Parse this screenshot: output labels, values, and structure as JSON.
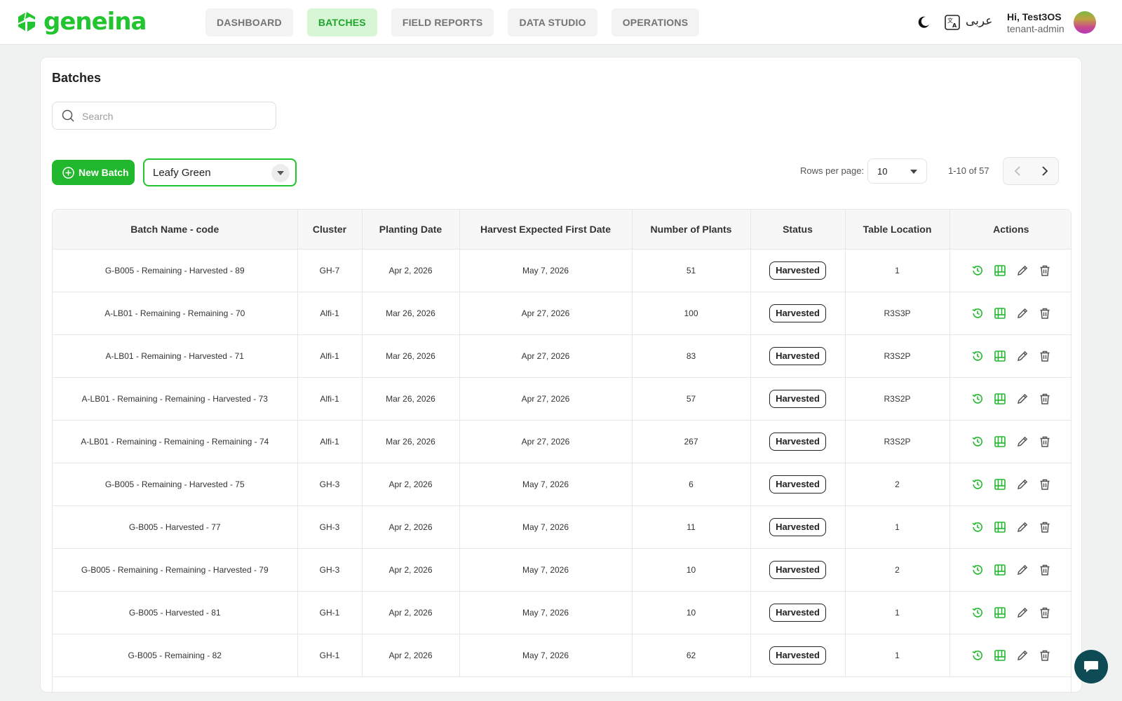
{
  "app": {
    "logo_text": "geneina"
  },
  "nav": {
    "tabs": [
      {
        "label": "DASHBOARD",
        "active": false
      },
      {
        "label": "BATCHES",
        "active": true
      },
      {
        "label": "FIELD REPORTS",
        "active": false
      },
      {
        "label": "DATA STUDIO",
        "active": false
      },
      {
        "label": "OPERATIONS",
        "active": false
      }
    ]
  },
  "header": {
    "theme_icon": "moon-icon",
    "translate_icon": "translate-icon",
    "language_label": "عربى",
    "greeting": "Hi, Test3OS",
    "role": "tenant-admin"
  },
  "page": {
    "title": "Batches",
    "search_placeholder": "Search",
    "new_batch_label": "New Batch",
    "crop_filter": "Leafy Green",
    "rows_per_page_label": "Rows per page:",
    "rows_per_page_value": "10",
    "range_text": "1-10 of 57"
  },
  "colors": {
    "brand": "#22c52f",
    "active_tab_bg": "#d7f6d6",
    "chat": "#0e4b55"
  },
  "table": {
    "columns": [
      "Batch Name - code",
      "Cluster",
      "Planting Date",
      "Harvest Expected First Date",
      "Number of Plants",
      "Status",
      "Table Location",
      "Actions"
    ],
    "rows": [
      {
        "name": "G-B005 - Remaining - Harvested - 89",
        "cluster": "GH-7",
        "planting": "Apr 2, 2026",
        "harvest": "May 7, 2026",
        "plants": "51",
        "status": "Harvested",
        "location": "1"
      },
      {
        "name": "A-LB01 - Remaining - Remaining - 70",
        "cluster": "Alfi-1",
        "planting": "Mar 26, 2026",
        "harvest": "Apr 27, 2026",
        "plants": "100",
        "status": "Harvested",
        "location": "R3S3P"
      },
      {
        "name": "A-LB01 - Remaining - Harvested - 71",
        "cluster": "Alfi-1",
        "planting": "Mar 26, 2026",
        "harvest": "Apr 27, 2026",
        "plants": "83",
        "status": "Harvested",
        "location": "R3S2P"
      },
      {
        "name": "A-LB01 - Remaining - Remaining - Harvested - 73",
        "cluster": "Alfi-1",
        "planting": "Mar 26, 2026",
        "harvest": "Apr 27, 2026",
        "plants": "57",
        "status": "Harvested",
        "location": "R3S2P"
      },
      {
        "name": "A-LB01 - Remaining - Remaining - Remaining - 74",
        "cluster": "Alfi-1",
        "planting": "Mar 26, 2026",
        "harvest": "Apr 27, 2026",
        "plants": "267",
        "status": "Harvested",
        "location": "R3S2P"
      },
      {
        "name": "G-B005 - Remaining - Harvested - 75",
        "cluster": "GH-3",
        "planting": "Apr 2, 2026",
        "harvest": "May 7, 2026",
        "plants": "6",
        "status": "Harvested",
        "location": "2"
      },
      {
        "name": "G-B005 - Harvested - 77",
        "cluster": "GH-3",
        "planting": "Apr 2, 2026",
        "harvest": "May 7, 2026",
        "plants": "11",
        "status": "Harvested",
        "location": "1"
      },
      {
        "name": "G-B005 - Remaining - Remaining - Harvested - 79",
        "cluster": "GH-3",
        "planting": "Apr 2, 2026",
        "harvest": "May 7, 2026",
        "plants": "10",
        "status": "Harvested",
        "location": "2"
      },
      {
        "name": "G-B005 - Harvested - 81",
        "cluster": "GH-1",
        "planting": "Apr 2, 2026",
        "harvest": "May 7, 2026",
        "plants": "10",
        "status": "Harvested",
        "location": "1"
      },
      {
        "name": "G-B005 - Remaining - 82",
        "cluster": "GH-1",
        "planting": "Apr 2, 2026",
        "harvest": "May 7, 2026",
        "plants": "62",
        "status": "Harvested",
        "location": "1"
      }
    ],
    "row_action_icons": [
      "history-icon",
      "table-view-icon",
      "edit-icon",
      "delete-icon"
    ]
  }
}
